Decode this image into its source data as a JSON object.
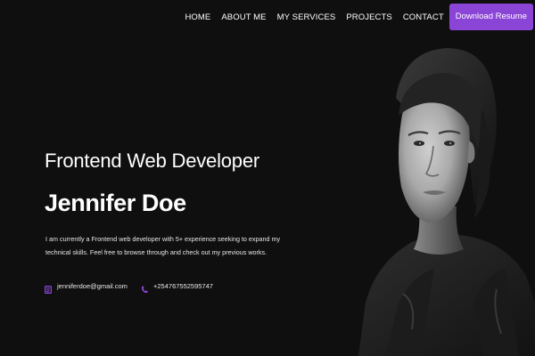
{
  "nav": {
    "links": [
      "HOME",
      "ABOUT ME",
      "MY SERVICES",
      "PROJECTS",
      "CONTACT"
    ],
    "cta_label": "Download Resume"
  },
  "hero": {
    "role": "Frontend Web Developer",
    "name": "Jennifer Doe",
    "intro": "I am currently a Frontend web developer with 5+ experience seeking to expand my technical skills. Feel free to browse through and check out my previous works.",
    "email": "jenniferdoe@gmail.com",
    "phone": "+254767552595747"
  },
  "theme": {
    "background": "#0f0f10",
    "accent": "#8b45d6"
  },
  "icons": {
    "email": "envelope-icon",
    "phone": "phone-icon"
  }
}
